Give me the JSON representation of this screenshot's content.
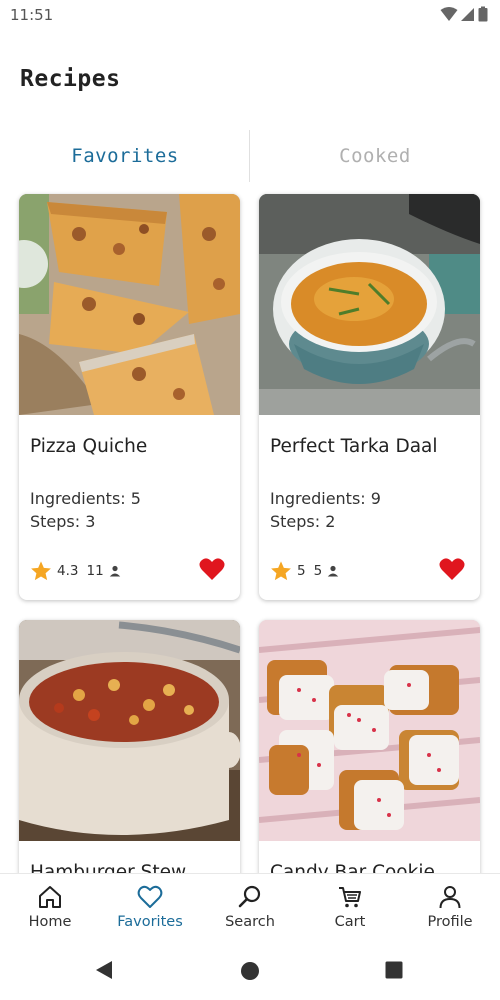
{
  "status_bar": {
    "time": "11:51"
  },
  "page": {
    "title": "Recipes"
  },
  "tabs": [
    {
      "label": "Favorites",
      "active": true
    },
    {
      "label": "Cooked",
      "active": false
    }
  ],
  "recipes": [
    {
      "name": "Pizza Quiche",
      "ingredients": "Ingredients: 5",
      "steps": "Steps: 3",
      "rating": "4.3",
      "ratings_count": "11",
      "favorited": true
    },
    {
      "name": "Perfect Tarka Daal",
      "ingredients": "Ingredients: 9",
      "steps": "Steps: 2",
      "rating": "5",
      "ratings_count": "5",
      "favorited": true
    },
    {
      "name": "Hamburger Stew",
      "favorited": true
    },
    {
      "name": "Candy Bar Cookie",
      "favorited": true
    }
  ],
  "bottom_nav": [
    {
      "label": "Home",
      "icon": "home-icon",
      "active": false
    },
    {
      "label": "Favorites",
      "icon": "heart-icon",
      "active": true
    },
    {
      "label": "Search",
      "icon": "search-icon",
      "active": false
    },
    {
      "label": "Cart",
      "icon": "cart-icon",
      "active": false
    },
    {
      "label": "Profile",
      "icon": "person-icon",
      "active": false
    }
  ],
  "colors": {
    "accent": "#1c6c99",
    "heart": "#e0161e",
    "star": "#f5a623",
    "inactive_tab": "#b0b0b0"
  }
}
